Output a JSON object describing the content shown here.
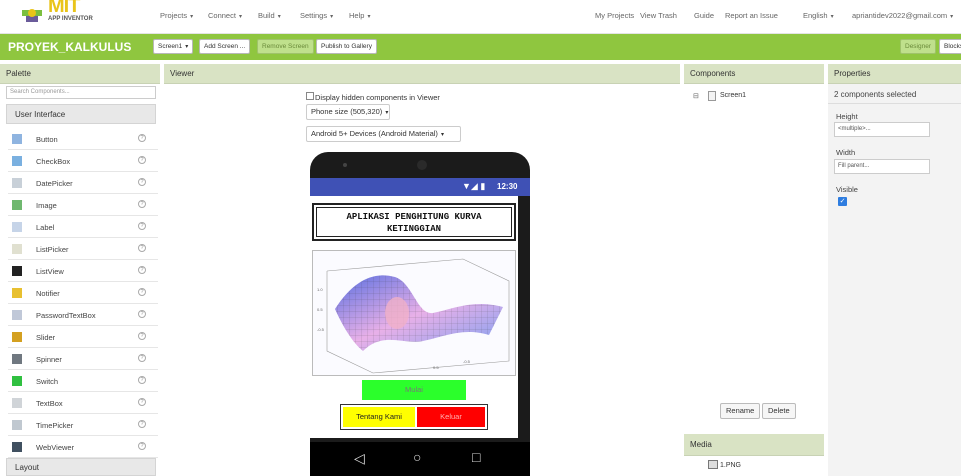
{
  "header": {
    "logo_text": "MIT",
    "logo_sub": "APP INVENTOR",
    "menus": [
      "Projects",
      "Connect",
      "Build",
      "Settings",
      "Help"
    ],
    "right_links": [
      "My Projects",
      "View Trash",
      "Guide",
      "Report an Issue"
    ],
    "language": "English",
    "account": "apriantidev2022@gmail.com"
  },
  "project": {
    "name": "PROYEK_KALKULUS",
    "screen_select": "Screen1",
    "buttons": [
      "Add Screen ...",
      "Remove Screen",
      "Publish to Gallery"
    ],
    "mode_designer": "Designer",
    "mode_blocks": "Blocks"
  },
  "palette": {
    "title": "Palette",
    "search_placeholder": "Search Components...",
    "section": "User Interface",
    "items": [
      "Button",
      "CheckBox",
      "DatePicker",
      "Image",
      "Label",
      "ListPicker",
      "ListView",
      "Notifier",
      "PasswordTextBox",
      "Slider",
      "Spinner",
      "Switch",
      "TextBox",
      "TimePicker",
      "WebViewer"
    ],
    "next_section": "Layout"
  },
  "viewer": {
    "title": "Viewer",
    "hidden_checkbox_label": "Display hidden components in Viewer",
    "phone_size": "Phone size (505,320)",
    "device_theme": "Android 5+ Devices (Android Material)",
    "status_time": "12:30",
    "app_title": "APLIKASI PENGHITUNG KURVA KETINGGIAN",
    "btn_mulai": "Mulai",
    "btn_tentang": "Tentang Kami",
    "btn_keluar": "Keluar"
  },
  "components": {
    "title": "Components",
    "tree_root": "Screen1",
    "rename": "Rename",
    "delete": "Delete",
    "media_title": "Media",
    "media_items": [
      "1.PNG"
    ]
  },
  "properties": {
    "title": "Properties",
    "subtitle": "2 components selected",
    "height_label": "Height",
    "height_value": "<multiple>...",
    "width_label": "Width",
    "width_value": "Fill parent...",
    "visible_label": "Visible"
  },
  "colors": {
    "accent_green": "#8fc63f",
    "panel_head": "#d9e3c4",
    "btn_mulai": "#2bff2b",
    "btn_tentang": "#ffff00",
    "btn_keluar": "#ff0000",
    "status_bar": "#3f51b5"
  }
}
